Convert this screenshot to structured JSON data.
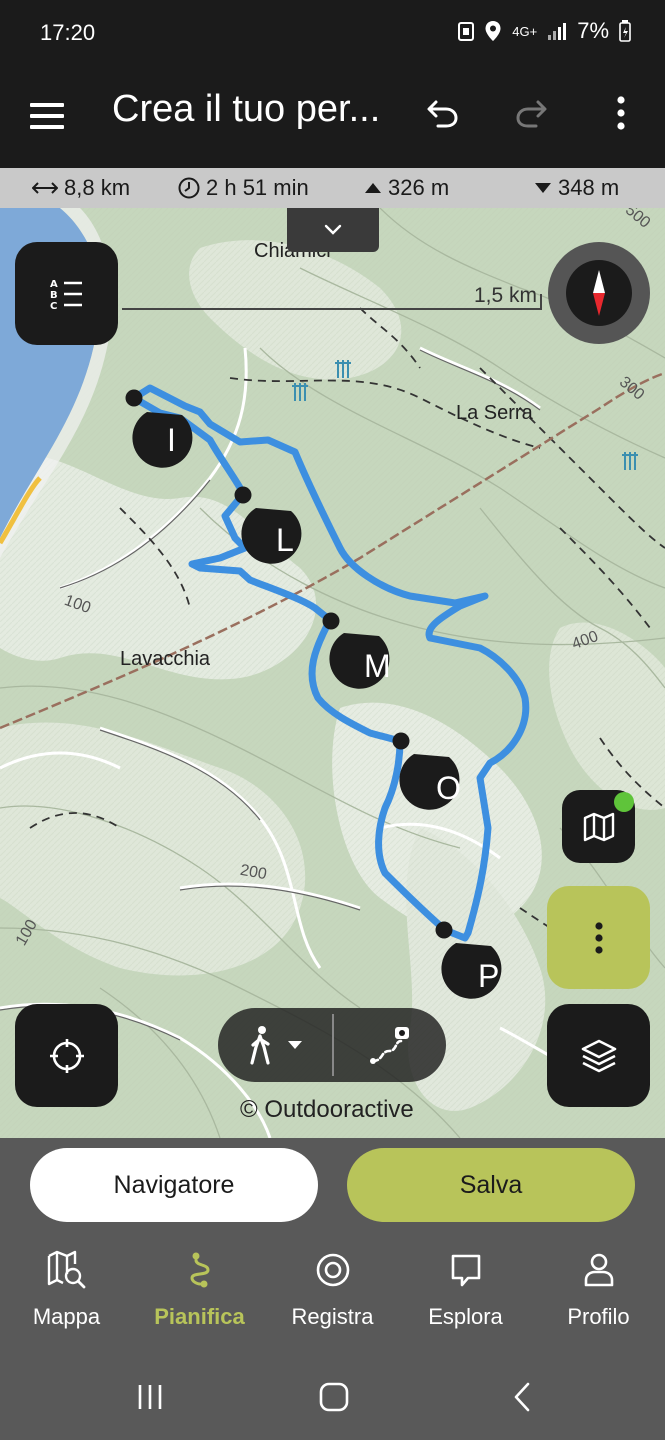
{
  "status": {
    "time": "17:20",
    "network": "4G+",
    "battery": "7%"
  },
  "app_bar": {
    "title": "Crea il tuo per...",
    "menu_icon": "hamburger-menu-icon",
    "undo_icon": "undo-icon",
    "redo_icon": "redo-icon",
    "more_icon": "more-vertical-icon"
  },
  "stats": {
    "distance": "8,8 km",
    "duration": "2 h 51 min",
    "ascent": "326 m",
    "descent": "348 m"
  },
  "map": {
    "scale": "1,5 km",
    "copyright": "© Outdooractive",
    "places": [
      "Chiamici",
      "La Serra",
      "Lavacchia"
    ],
    "contours": [
      "500",
      "300",
      "400",
      "100",
      "100",
      "200"
    ],
    "waypoints": [
      "I",
      "L",
      "M",
      "O",
      "P"
    ],
    "route_color": "#3d8fe0",
    "accent_color": "#b8c45a"
  },
  "actions": {
    "navigator_label": "Navigatore",
    "save_label": "Salva"
  },
  "bottom_nav": {
    "items": [
      {
        "label": "Mappa",
        "icon": "map-search-icon"
      },
      {
        "label": "Pianifica",
        "icon": "route-plan-icon",
        "active": true
      },
      {
        "label": "Registra",
        "icon": "record-icon"
      },
      {
        "label": "Esplora",
        "icon": "explore-icon"
      },
      {
        "label": "Profilo",
        "icon": "profile-icon"
      }
    ]
  }
}
